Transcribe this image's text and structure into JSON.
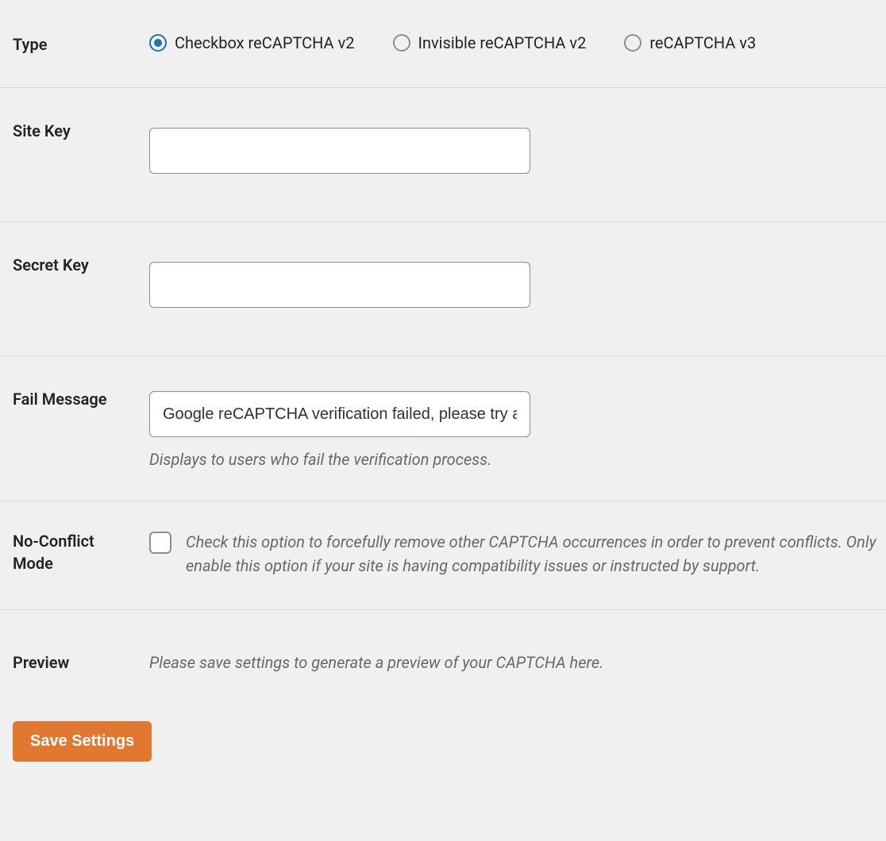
{
  "fields": {
    "type": {
      "label": "Type",
      "options": [
        {
          "label": "Checkbox reCAPTCHA v2",
          "checked": true
        },
        {
          "label": "Invisible reCAPTCHA v2",
          "checked": false
        },
        {
          "label": "reCAPTCHA v3",
          "checked": false
        }
      ]
    },
    "site_key": {
      "label": "Site Key",
      "value": ""
    },
    "secret_key": {
      "label": "Secret Key",
      "value": ""
    },
    "fail_message": {
      "label": "Fail Message",
      "value": "Google reCAPTCHA verification failed, please try again later.",
      "description": "Displays to users who fail the verification process."
    },
    "no_conflict": {
      "label": "No-Conflict Mode",
      "checked": false,
      "description": "Check this option to forcefully remove other CAPTCHA occurrences in order to prevent conflicts. Only enable this option if your site is having compatibility issues or instructed by support."
    },
    "preview": {
      "label": "Preview",
      "message": "Please save settings to generate a preview of your CAPTCHA here."
    }
  },
  "submit": {
    "label": "Save Settings"
  }
}
